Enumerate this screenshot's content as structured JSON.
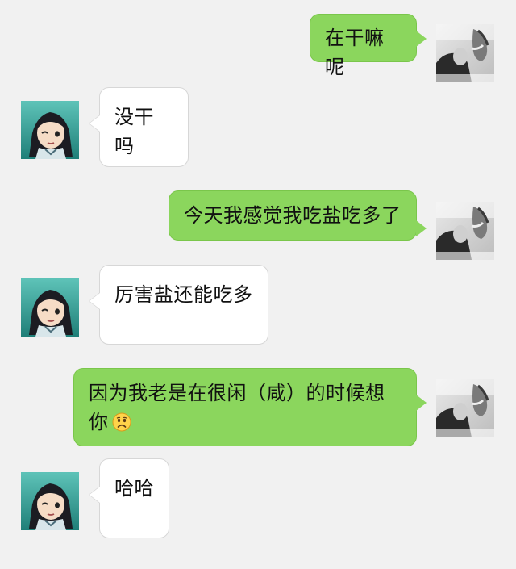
{
  "conversation": {
    "messages": [
      {
        "sender": "self",
        "text": "在干嘛呢"
      },
      {
        "sender": "other",
        "text": "没干吗"
      },
      {
        "sender": "self",
        "text": "今天我感觉我吃盐吃多了"
      },
      {
        "sender": "other",
        "text": "厉害盐还能吃多"
      },
      {
        "sender": "self",
        "text_line1": "因为我老是在很闲（咸）的时候想",
        "text_line2": "你",
        "emoji": "frowning-face-emoji"
      },
      {
        "sender": "other",
        "text": "哈哈"
      }
    ]
  },
  "colors": {
    "background": "#f1f1f1",
    "self_bubble": "#8bd65d",
    "other_bubble": "#ffffff"
  },
  "avatars": {
    "self": "portrait-photo-avatar",
    "other": "cartoon-girl-avatar"
  }
}
